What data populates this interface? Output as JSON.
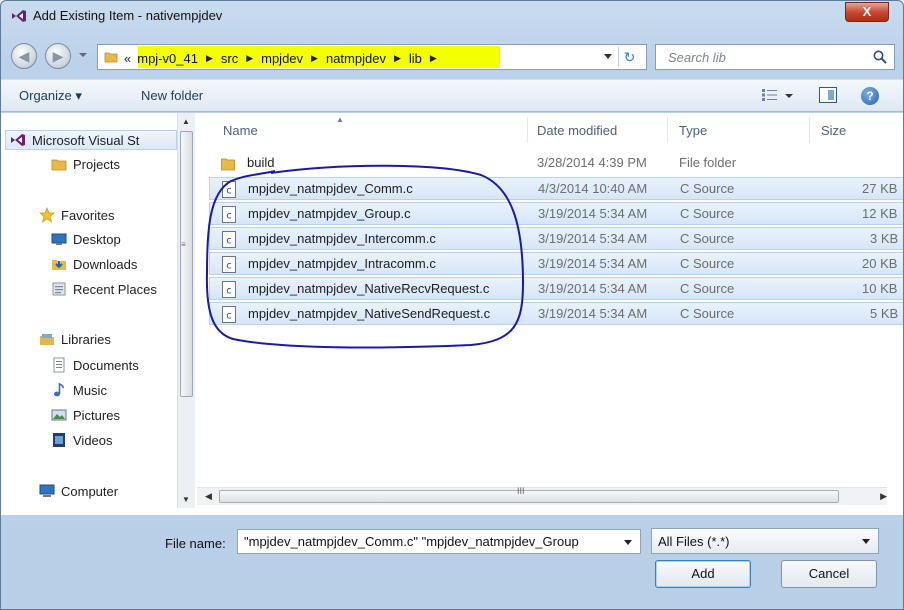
{
  "window": {
    "title": "Add Existing Item - nativempjdev",
    "close_label": "X"
  },
  "address": {
    "overflow": "«",
    "crumbs": [
      "mpj-v0_41",
      "src",
      "mpjdev",
      "natmpjdev",
      "lib"
    ],
    "highlight_color": "#f4ff00"
  },
  "search": {
    "placeholder": "Search lib"
  },
  "toolbar": {
    "organize_label": "Organize ▾",
    "new_folder_label": "New folder",
    "help_label": "?"
  },
  "nav": {
    "items": [
      {
        "label": "Microsoft Visual St",
        "icon": "visual-studio-icon",
        "selected": true
      },
      {
        "label": "Projects",
        "icon": "folder-icon"
      },
      {
        "label": "Favorites",
        "icon": "star-icon"
      },
      {
        "label": "Desktop",
        "icon": "desktop-icon"
      },
      {
        "label": "Downloads",
        "icon": "downloads-icon"
      },
      {
        "label": "Recent Places",
        "icon": "recent-places-icon"
      },
      {
        "label": "Libraries",
        "icon": "libraries-icon"
      },
      {
        "label": "Documents",
        "icon": "documents-icon"
      },
      {
        "label": "Music",
        "icon": "music-icon"
      },
      {
        "label": "Pictures",
        "icon": "pictures-icon"
      },
      {
        "label": "Videos",
        "icon": "videos-icon"
      },
      {
        "label": "Computer",
        "icon": "computer-icon"
      }
    ]
  },
  "columns": {
    "name": "Name",
    "date": "Date modified",
    "type": "Type",
    "size": "Size"
  },
  "files": [
    {
      "name": "build",
      "date": "3/28/2014 4:39 PM",
      "type": "File folder",
      "size": "",
      "icon": "folder-icon",
      "selected": false
    },
    {
      "name": "mpjdev_natmpjdev_Comm.c",
      "date": "4/3/2014 10:40 AM",
      "type": "C Source",
      "size": "27 KB",
      "icon": "c-source-file-icon",
      "selected": true
    },
    {
      "name": "mpjdev_natmpjdev_Group.c",
      "date": "3/19/2014 5:34 AM",
      "type": "C Source",
      "size": "12 KB",
      "icon": "c-source-file-icon",
      "selected": true
    },
    {
      "name": "mpjdev_natmpjdev_Intercomm.c",
      "date": "3/19/2014 5:34 AM",
      "type": "C Source",
      "size": "3 KB",
      "icon": "c-source-file-icon",
      "selected": true
    },
    {
      "name": "mpjdev_natmpjdev_Intracomm.c",
      "date": "3/19/2014 5:34 AM",
      "type": "C Source",
      "size": "20 KB",
      "icon": "c-source-file-icon",
      "selected": true
    },
    {
      "name": "mpjdev_natmpjdev_NativeRecvRequest.c",
      "date": "3/19/2014 5:34 AM",
      "type": "C Source",
      "size": "10 KB",
      "icon": "c-source-file-icon",
      "selected": true
    },
    {
      "name": "mpjdev_natmpjdev_NativeSendRequest.c",
      "date": "3/19/2014 5:34 AM",
      "type": "C Source",
      "size": "5 KB",
      "icon": "c-source-file-icon",
      "selected": true
    }
  ],
  "footer": {
    "file_name_label": "File name:",
    "file_name_value": "\"mpjdev_natmpjdev_Comm.c\" \"mpjdev_natmpjdev_Group",
    "file_type_value": "All Files (*.*)",
    "add_label": "Add",
    "cancel_label": "Cancel"
  },
  "annotation": {
    "color": "#1a1aa8"
  }
}
